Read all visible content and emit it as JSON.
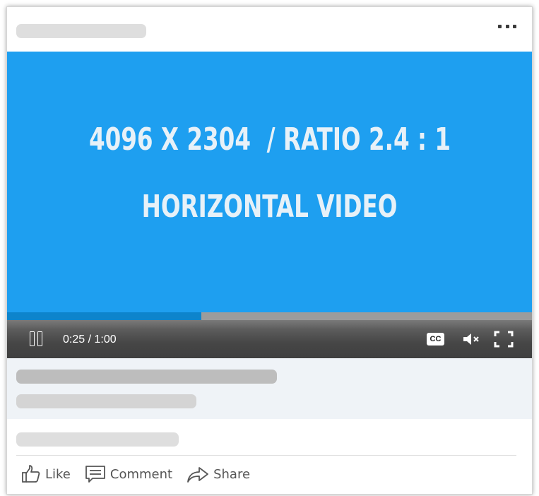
{
  "video": {
    "line1": "4096 X 2304  / RATIO 2.4 : 1",
    "line2": "HORIZONTAL VIDEO",
    "background_color": "#1e9ff0",
    "progress_fraction": 0.37
  },
  "player": {
    "time": "0:25 / 1:00",
    "cc_label": "CC",
    "icons": [
      "pause-icon",
      "closed-captions-icon",
      "mute-icon",
      "fullscreen-icon"
    ]
  },
  "header": {
    "menu_icon": "more-options-icon"
  },
  "actions": {
    "like_label": "Like",
    "comment_label": "Comment",
    "share_label": "Share"
  }
}
